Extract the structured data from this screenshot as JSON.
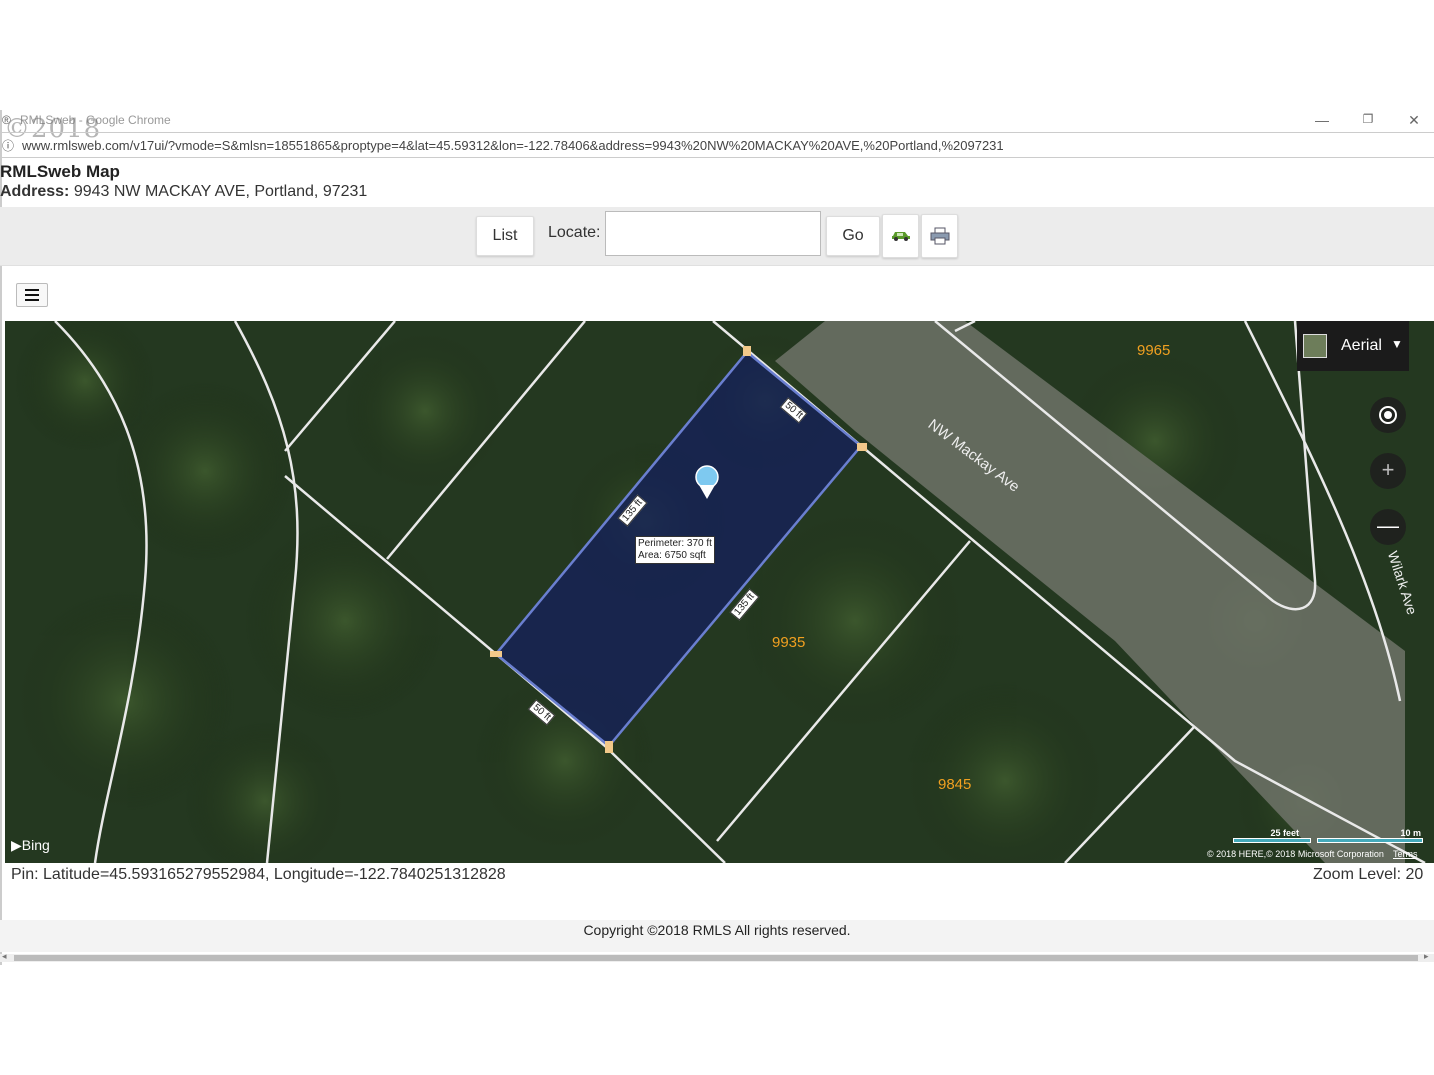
{
  "browser": {
    "title": "RMLSweb - Google Chrome",
    "watermark": "©2018",
    "url": "www.rmlsweb.com/v17ui/?vmode=S&mlsn=18551865&proptype=4&lat=45.59312&lon=-122.78406&address=9943%20NW%20MACKAY%20AVE,%20Portland,%2097231",
    "window_buttons": [
      "—",
      "❐",
      "✕"
    ]
  },
  "header": {
    "title": "RMLSweb Map",
    "address_label": "Address:",
    "address_value": "9943 NW MACKAY AVE, Portland, 97231"
  },
  "toolbar": {
    "list_label": "List",
    "locate_label": "Locate:",
    "locate_value": "",
    "go_label": "Go",
    "car_icon": "car-icon",
    "print_icon": "printer-icon"
  },
  "map": {
    "layer_label": "Aerial",
    "street_mackay": "NW Mackay Ave",
    "street_wilark": "Wilark Ave",
    "parcel_numbers": [
      "9965",
      "9935",
      "9845"
    ],
    "dimension_labels": [
      "50 ft",
      "135 ft",
      "135 ft",
      "50 ft"
    ],
    "measure_perimeter": "Perimeter: 370 ft",
    "measure_area": "Area: 6750 sqft",
    "provider": "Bing",
    "scale_feet": "25 feet",
    "scale_meters": "10 m",
    "copyright": "© 2018 HERE,© 2018 Microsoft Corporation",
    "terms": "Terms",
    "colors": {
      "parcel_fill": "#14205a",
      "parcel_stroke": "#6a7fd0",
      "parcel_number": "#f0a020"
    }
  },
  "status": {
    "pin": "Pin: Latitude=45.593165279552984, Longitude=-122.7840251312828",
    "zoom": "Zoom Level: 20"
  },
  "footer": {
    "copyright": "Copyright ©2018 RMLS All rights reserved."
  }
}
